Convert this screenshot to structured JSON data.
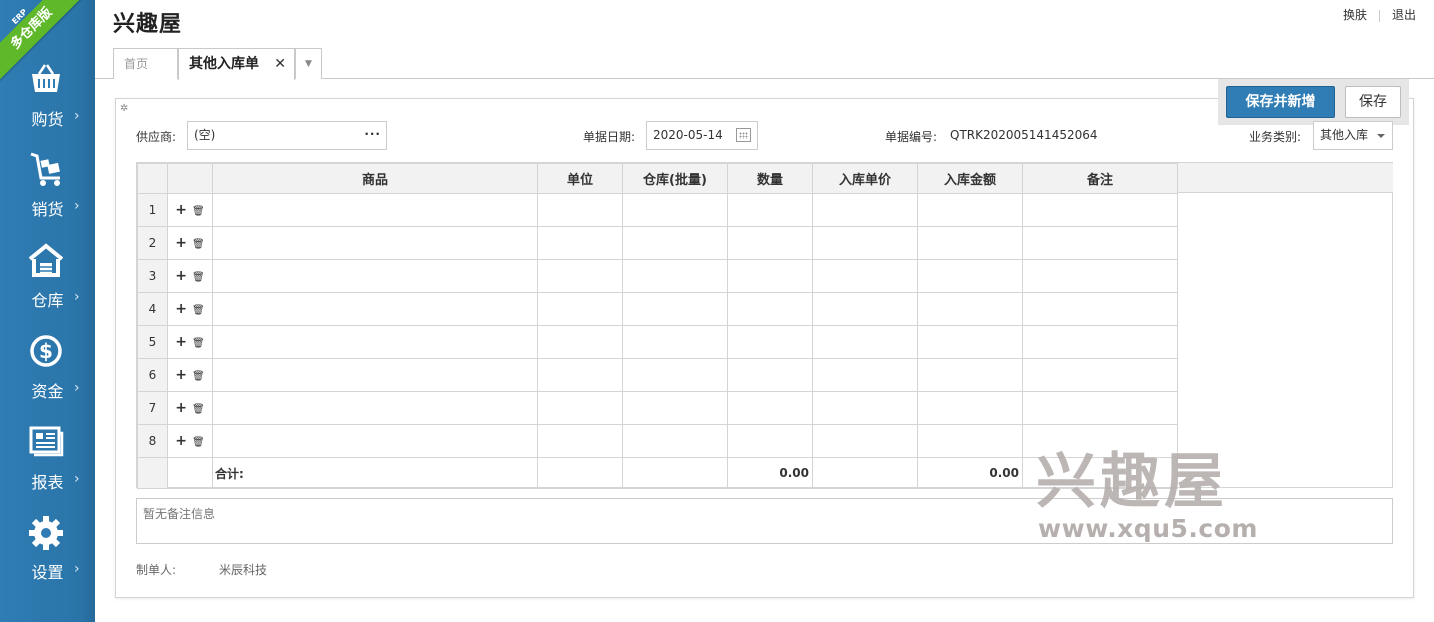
{
  "brand": {
    "ribbon_top": "ERP",
    "ribbon_main": "多仓库版",
    "ribbon_color": "#5fb82a",
    "sidebar_color": "#2f7db4"
  },
  "sidebar": {
    "items": [
      {
        "label": "购货",
        "arrow": "›",
        "icon": "basket-icon"
      },
      {
        "label": "销货",
        "arrow": "›",
        "icon": "cart-icon"
      },
      {
        "label": "仓库",
        "arrow": "›",
        "icon": "warehouse-icon"
      },
      {
        "label": "资金",
        "arrow": "›",
        "icon": "dollar-icon"
      },
      {
        "label": "报表",
        "arrow": "›",
        "icon": "report-icon"
      },
      {
        "label": "设置",
        "arrow": "›",
        "icon": "gear-icon"
      }
    ]
  },
  "header": {
    "title": "兴趣屋",
    "skin_link": "换肤",
    "logout_link": "退出"
  },
  "tabs": {
    "home": "首页",
    "active": "其他入库单",
    "close": "✕",
    "more": "▼"
  },
  "toolbar": {
    "save_new_label": "保存并新增",
    "save_label": "保存"
  },
  "form": {
    "supplier_label": "供应商:",
    "supplier_value": "(空)",
    "supplier_more": "···",
    "date_label": "单据日期:",
    "date_value": "2020-05-14",
    "number_label": "单据编号:",
    "number_value": "QTRK202005141452064",
    "type_label": "业务类别:",
    "type_value": "其他入库"
  },
  "grid": {
    "columns": [
      "商品",
      "单位",
      "仓库(批量)",
      "数量",
      "入库单价",
      "入库金额",
      "备注"
    ],
    "rows": [
      "1",
      "2",
      "3",
      "4",
      "5",
      "6",
      "7",
      "8"
    ],
    "total_label": "合计:",
    "total_quantity": "0.00",
    "total_amount": "0.00"
  },
  "remark": {
    "placeholder": "暂无备注信息"
  },
  "footer": {
    "maker_label": "制单人:",
    "maker_value": "米辰科技"
  },
  "watermark": {
    "text": "兴趣屋",
    "url": "www.xqu5.com"
  }
}
